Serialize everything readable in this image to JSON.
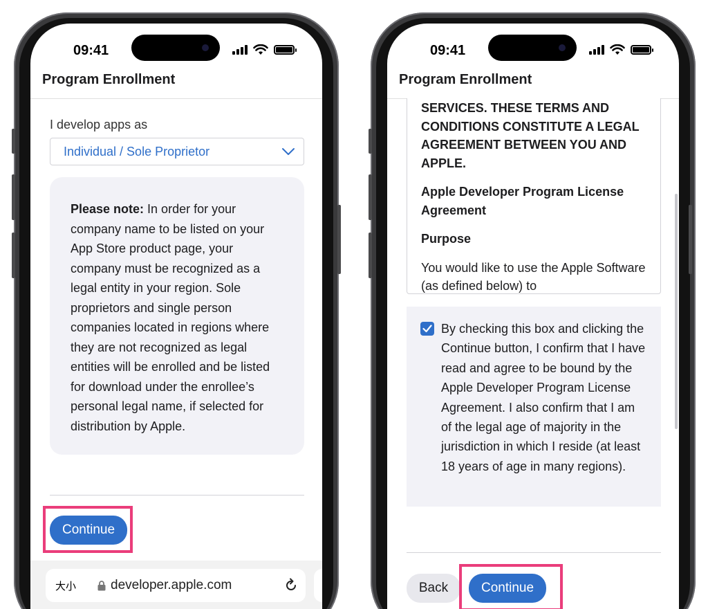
{
  "status_bar": {
    "time": "09:41"
  },
  "left_screen": {
    "nav_title": "Program Enrollment",
    "field_label": "I develop apps as",
    "select_value": "Individual / Sole Proprietor",
    "note_title": "Please note:",
    "note_body": " In order for your company name to be listed on your App Store product page, your company must be recognized as a legal entity in your region. Sole proprietors and single person companies located in regions where they are not recognized as legal entities will be enrolled and be listed for download under the enrollee’s personal legal name, if selected for distribution by Apple.",
    "continue_label": "Continue",
    "url_aa": "大小",
    "url_text": "developer.apple.com"
  },
  "right_screen": {
    "nav_title": "Program Enrollment",
    "terms_caps": "SERVICES.  THESE TERMS AND CONDITIONS CONSTITUTE A LEGAL AGREEMENT BETWEEN YOU AND APPLE.",
    "terms_heading": "Apple Developer Program License Agreement",
    "terms_subheading": "Purpose",
    "terms_body": "You would like to use the Apple Software (as defined below) to",
    "agree_checked": true,
    "agree_text": "By checking this box and clicking the Continue button, I confirm that I have read and agree to be bound by the Apple Developer Program License Agreement. I also confirm that I am of the legal age of majority in the jurisdiction in which I reside (at least 18 years of age in many regions).",
    "back_label": "Back",
    "continue_label": "Continue"
  },
  "colors": {
    "accent": "#2f6fc9",
    "highlight": "#ea3d7b"
  }
}
